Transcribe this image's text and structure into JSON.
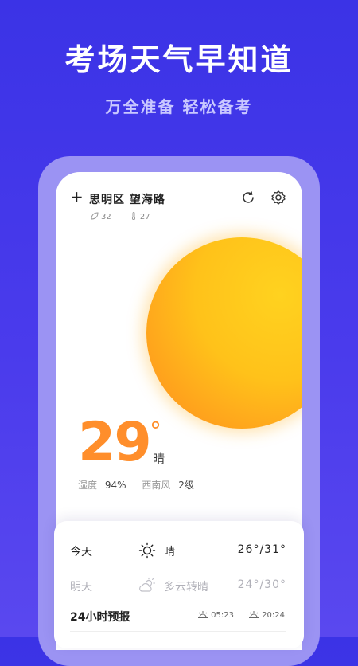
{
  "promo": {
    "headline": "考场天气早知道",
    "subline": "万全准备 轻松备考"
  },
  "header": {
    "location": "思明区 望海路",
    "aqi": "32",
    "temp_small": "27"
  },
  "current": {
    "temperature": "29",
    "degree_symbol": "°",
    "condition": "晴",
    "humidity_label": "湿度",
    "humidity_value": "94%",
    "wind_label": "西南风",
    "wind_value": "2级"
  },
  "forecast": {
    "days": [
      {
        "day": "今天",
        "condition": "晴",
        "range": "26°/31°",
        "icon": "sun-icon"
      },
      {
        "day": "明天",
        "condition": "多云转晴",
        "range": "24°/30°",
        "icon": "partly-cloudy-icon"
      }
    ],
    "hourly_title": "24小时预报",
    "sunrise": "05:23",
    "sunset": "20:24"
  },
  "colors": {
    "background": "#3b33e6",
    "accent": "#ff8e2b",
    "sun": "#ffc21a"
  }
}
